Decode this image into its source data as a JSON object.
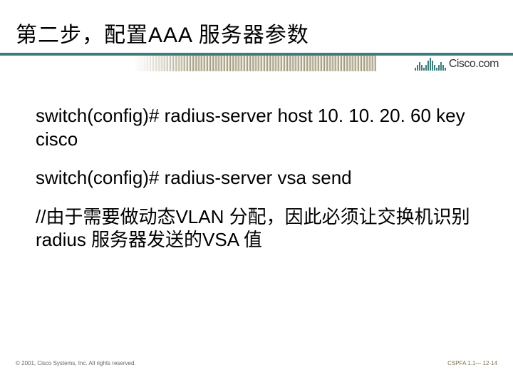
{
  "title": "第二步，配置AAA 服务器参数",
  "logo_text": "Cisco.com",
  "content": {
    "line1": "switch(config)# radius-server host 10. 10. 20. 60 key cisco",
    "line2": "switch(config)# radius-server vsa send",
    "line3": "//由于需要做动态VLAN 分配，因此必须让交换机识别radius 服务器发送的VSA 值"
  },
  "footer": {
    "left": "© 2001, Cisco Systems, Inc. All rights reserved.",
    "right": "CSPFA 1.1— 12-14"
  }
}
